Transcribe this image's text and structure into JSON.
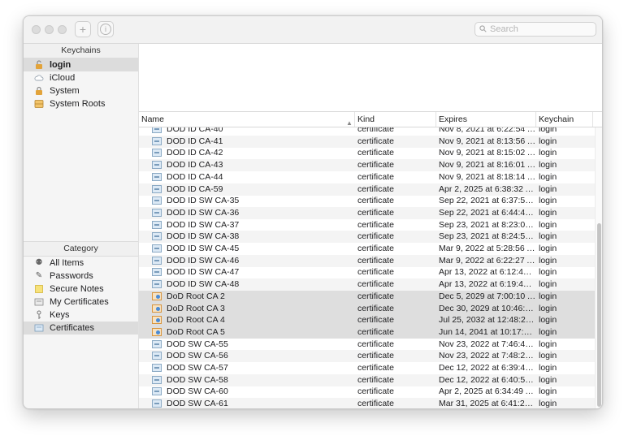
{
  "toolbar": {
    "add_icon": "plus-icon",
    "info_icon": "info-icon",
    "search_placeholder": "Search"
  },
  "sidebar": {
    "keychains_header": "Keychains",
    "keychains": [
      {
        "label": "login",
        "icon": "lock-open-icon"
      },
      {
        "label": "iCloud",
        "icon": "cloud-icon"
      },
      {
        "label": "System",
        "icon": "lock-icon"
      },
      {
        "label": "System Roots",
        "icon": "cabinet-icon"
      }
    ],
    "category_header": "Category",
    "categories": [
      {
        "label": "All Items",
        "icon": "all-items-icon"
      },
      {
        "label": "Passwords",
        "icon": "pen-icon"
      },
      {
        "label": "Secure Notes",
        "icon": "note-icon"
      },
      {
        "label": "My Certificates",
        "icon": "my-certificate-icon"
      },
      {
        "label": "Keys",
        "icon": "key-icon"
      },
      {
        "label": "Certificates",
        "icon": "certificate-icon"
      }
    ]
  },
  "list": {
    "columns": {
      "name": "Name",
      "kind": "Kind",
      "expires": "Expires",
      "keychain": "Keychain"
    },
    "rows": [
      {
        "name": "DOD ID CA-40",
        "kind": "certificate",
        "expires": "Nov 8, 2021 at 6:22:54 AM",
        "keychain": "login"
      },
      {
        "name": "DOD ID CA-41",
        "kind": "certificate",
        "expires": "Nov 9, 2021 at 8:13:56 AM",
        "keychain": "login"
      },
      {
        "name": "DOD ID CA-42",
        "kind": "certificate",
        "expires": "Nov 9, 2021 at 8:15:02 AM",
        "keychain": "login"
      },
      {
        "name": "DOD ID CA-43",
        "kind": "certificate",
        "expires": "Nov 9, 2021 at 8:16:01 AM",
        "keychain": "login"
      },
      {
        "name": "DOD ID CA-44",
        "kind": "certificate",
        "expires": "Nov 9, 2021 at 8:18:14 AM",
        "keychain": "login"
      },
      {
        "name": "DOD ID CA-59",
        "kind": "certificate",
        "expires": "Apr 2, 2025 at 6:38:32 AM",
        "keychain": "login"
      },
      {
        "name": "DOD ID SW CA-35",
        "kind": "certificate",
        "expires": "Sep 22, 2021 at 6:37:50...",
        "keychain": "login"
      },
      {
        "name": "DOD ID SW CA-36",
        "kind": "certificate",
        "expires": "Sep 22, 2021 at 6:44:42...",
        "keychain": "login"
      },
      {
        "name": "DOD ID SW CA-37",
        "kind": "certificate",
        "expires": "Sep 23, 2021 at 8:23:05...",
        "keychain": "login"
      },
      {
        "name": "DOD ID SW CA-38",
        "kind": "certificate",
        "expires": "Sep 23, 2021 at 8:24:51...",
        "keychain": "login"
      },
      {
        "name": "DOD ID SW CA-45",
        "kind": "certificate",
        "expires": "Mar 9, 2022 at 5:28:56 AM",
        "keychain": "login"
      },
      {
        "name": "DOD ID SW CA-46",
        "kind": "certificate",
        "expires": "Mar 9, 2022 at 6:22:27 AM",
        "keychain": "login"
      },
      {
        "name": "DOD ID SW CA-47",
        "kind": "certificate",
        "expires": "Apr 13, 2022 at 6:12:43 AM",
        "keychain": "login"
      },
      {
        "name": "DOD ID SW CA-48",
        "kind": "certificate",
        "expires": "Apr 13, 2022 at 6:19:49 A...",
        "keychain": "login"
      },
      {
        "name": "DoD Root CA 2",
        "kind": "certificate",
        "expires": "Dec 5, 2029 at 7:00:10 AM",
        "keychain": "login",
        "selected": true,
        "root": true
      },
      {
        "name": "DoD Root CA 3",
        "kind": "certificate",
        "expires": "Dec 30, 2029 at 10:46:41...",
        "keychain": "login",
        "selected": true,
        "root": true
      },
      {
        "name": "DoD Root CA 4",
        "kind": "certificate",
        "expires": "Jul 25, 2032 at 12:48:23...",
        "keychain": "login",
        "selected": true,
        "root": true
      },
      {
        "name": "DoD Root CA 5",
        "kind": "certificate",
        "expires": "Jun 14, 2041 at 10:17:27...",
        "keychain": "login",
        "selected": true,
        "root": true
      },
      {
        "name": "DOD SW CA-55",
        "kind": "certificate",
        "expires": "Nov 23, 2022 at 7:46:46...",
        "keychain": "login"
      },
      {
        "name": "DOD SW CA-56",
        "kind": "certificate",
        "expires": "Nov 23, 2022 at 7:48:22...",
        "keychain": "login"
      },
      {
        "name": "DOD SW CA-57",
        "kind": "certificate",
        "expires": "Dec 12, 2022 at 6:39:49...",
        "keychain": "login"
      },
      {
        "name": "DOD SW CA-58",
        "kind": "certificate",
        "expires": "Dec 12, 2022 at 6:40:52...",
        "keychain": "login"
      },
      {
        "name": "DOD SW CA-60",
        "kind": "certificate",
        "expires": "Apr 2, 2025 at 6:34:49 AM",
        "keychain": "login"
      },
      {
        "name": "DOD SW CA-61",
        "kind": "certificate",
        "expires": "Mar 31, 2025 at 6:41:24...",
        "keychain": "login"
      }
    ]
  }
}
